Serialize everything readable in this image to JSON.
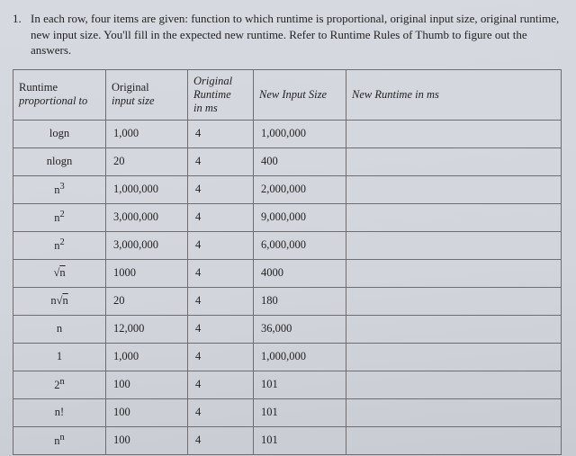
{
  "question": {
    "number": "1.",
    "text": "In each row, four items are given:  function to which runtime is proportional, original input size, original runtime, new input size.  You'll fill in the expected new runtime.  Refer to Runtime Rules of Thumb to figure out the answers."
  },
  "columns": {
    "c1_line1": "Runtime",
    "c1_line2": "proportional to",
    "c2_line1": "Original",
    "c2_line2": "input size",
    "c3_line1": "Original",
    "c3_line2": "Runtime",
    "c3_line3": "in ms",
    "c4": "New Input Size",
    "c5": "New Runtime in ms"
  },
  "rows": [
    {
      "fn_html": "logn",
      "orig_size": "1,000",
      "orig_rt": "4",
      "new_size": "1,000,000",
      "new_rt": ""
    },
    {
      "fn_html": "nlogn",
      "orig_size": "20",
      "orig_rt": "4",
      "new_size": "400",
      "new_rt": ""
    },
    {
      "fn_html": "n<sup>3</sup>",
      "orig_size": "1,000,000",
      "orig_rt": "4",
      "new_size": "2,000,000",
      "new_rt": ""
    },
    {
      "fn_html": "n<sup>2</sup>",
      "orig_size": "3,000,000",
      "orig_rt": "4",
      "new_size": "9,000,000",
      "new_rt": ""
    },
    {
      "fn_html": "n<sup>2</sup>",
      "orig_size": "3,000,000",
      "orig_rt": "4",
      "new_size": "6,000,000",
      "new_rt": ""
    },
    {
      "fn_html": "&radic;<span style=\"text-decoration:overline\">n</span>",
      "orig_size": "1000",
      "orig_rt": "4",
      "new_size": "4000",
      "new_rt": ""
    },
    {
      "fn_html": "n&radic;<span style=\"text-decoration:overline\">n</span>",
      "orig_size": "20",
      "orig_rt": "4",
      "new_size": "180",
      "new_rt": ""
    },
    {
      "fn_html": "n",
      "orig_size": "12,000",
      "orig_rt": "4",
      "new_size": "36,000",
      "new_rt": ""
    },
    {
      "fn_html": "1",
      "orig_size": "1,000",
      "orig_rt": "4",
      "new_size": "1,000,000",
      "new_rt": ""
    },
    {
      "fn_html": "2<sup>n</sup>",
      "orig_size": "100",
      "orig_rt": "4",
      "new_size": "101",
      "new_rt": ""
    },
    {
      "fn_html": "n!",
      "orig_size": "100",
      "orig_rt": "4",
      "new_size": "101",
      "new_rt": ""
    },
    {
      "fn_html": "n<sup>n</sup>",
      "orig_size": "100",
      "orig_rt": "4",
      "new_size": "101",
      "new_rt": ""
    }
  ]
}
